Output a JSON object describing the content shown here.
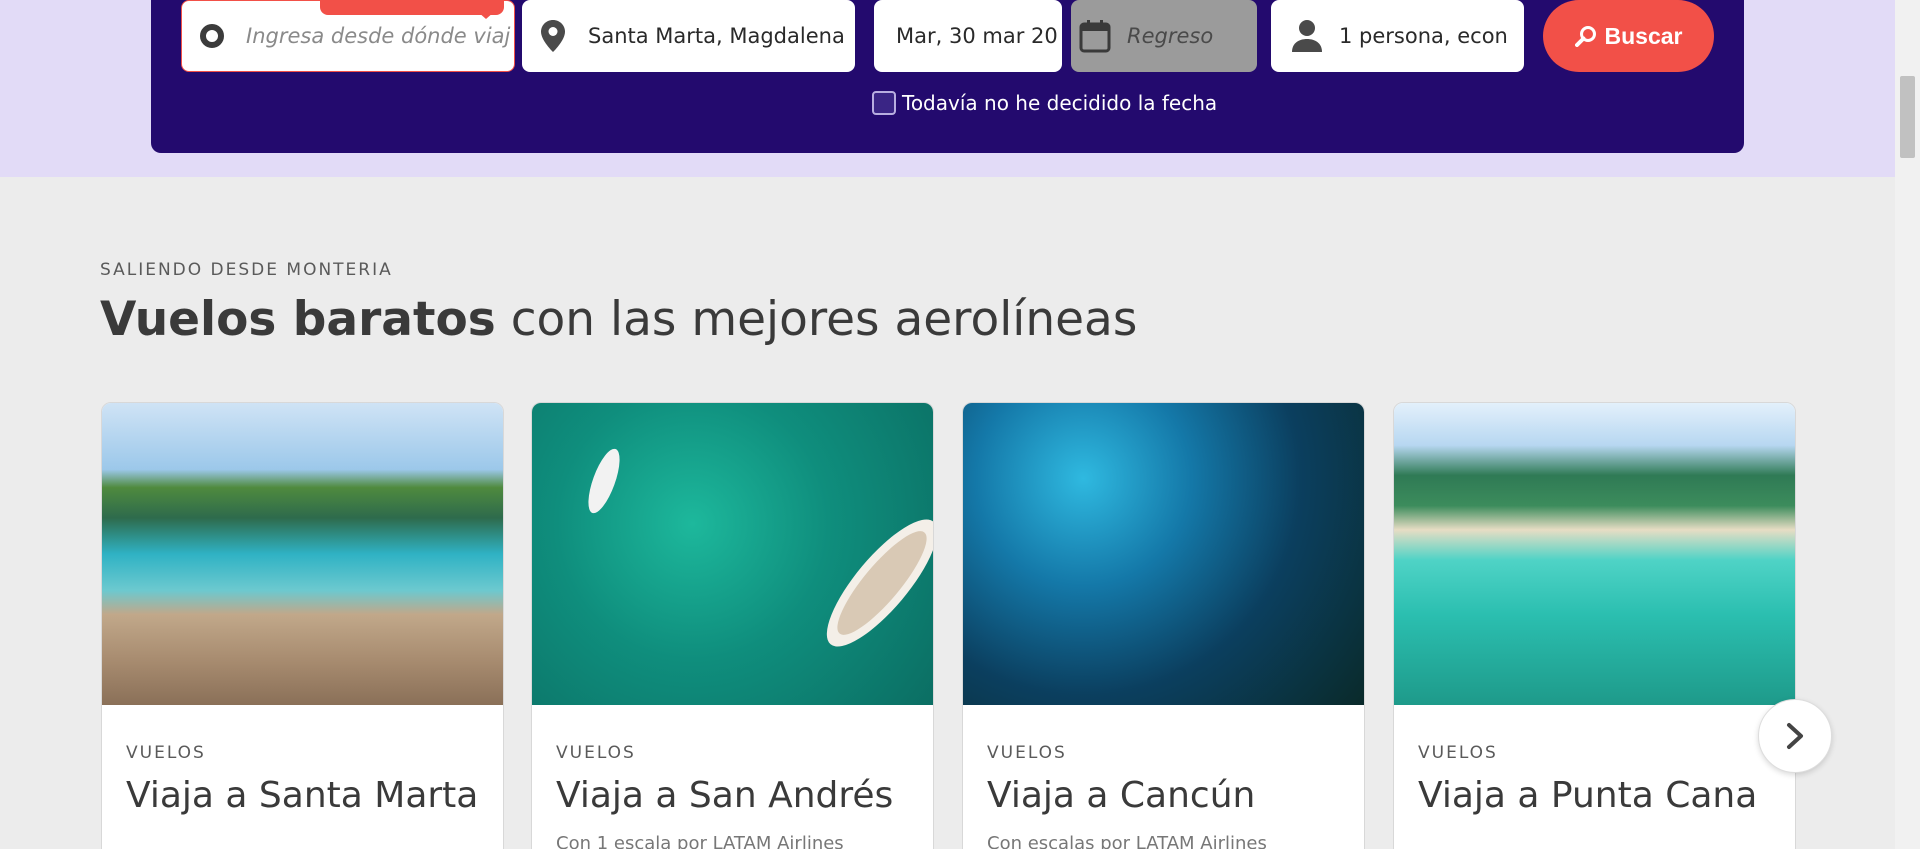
{
  "search": {
    "origin_placeholder": "Ingresa desde dónde viaj",
    "destination_value": "Santa Marta, Magdalena",
    "depart_value": "Mar, 30 mar 20",
    "return_placeholder": "Regreso",
    "passengers_value": "1 persona, econ",
    "search_label": "Buscar",
    "undecided_label": "Todavía no he decidido la fecha",
    "undecided_checked": false
  },
  "section": {
    "kicker": "SALIENDO DESDE MONTERIA",
    "headline_bold": "Vuelos baratos",
    "headline_rest": " con las mejores aerolíneas"
  },
  "cards": [
    {
      "category": "VUELOS",
      "title": "Viaja a Santa Marta",
      "subtitle": ""
    },
    {
      "category": "VUELOS",
      "title": "Viaja a San Andrés",
      "subtitle": "Con 1 escala por LATAM Airlines"
    },
    {
      "category": "VUELOS",
      "title": "Viaja a Cancún",
      "subtitle": "Con escalas por LATAM Airlines"
    },
    {
      "category": "VUELOS",
      "title": "Viaja a Punta Cana",
      "subtitle": ""
    }
  ],
  "colors": {
    "panel": "#230a6e",
    "accent": "#f25048",
    "hero_band": "#e2dbf7"
  },
  "icons": [
    "origin-ring-icon",
    "location-pin-icon",
    "calendar-icon",
    "person-icon",
    "search-icon",
    "chevron-right-icon"
  ]
}
